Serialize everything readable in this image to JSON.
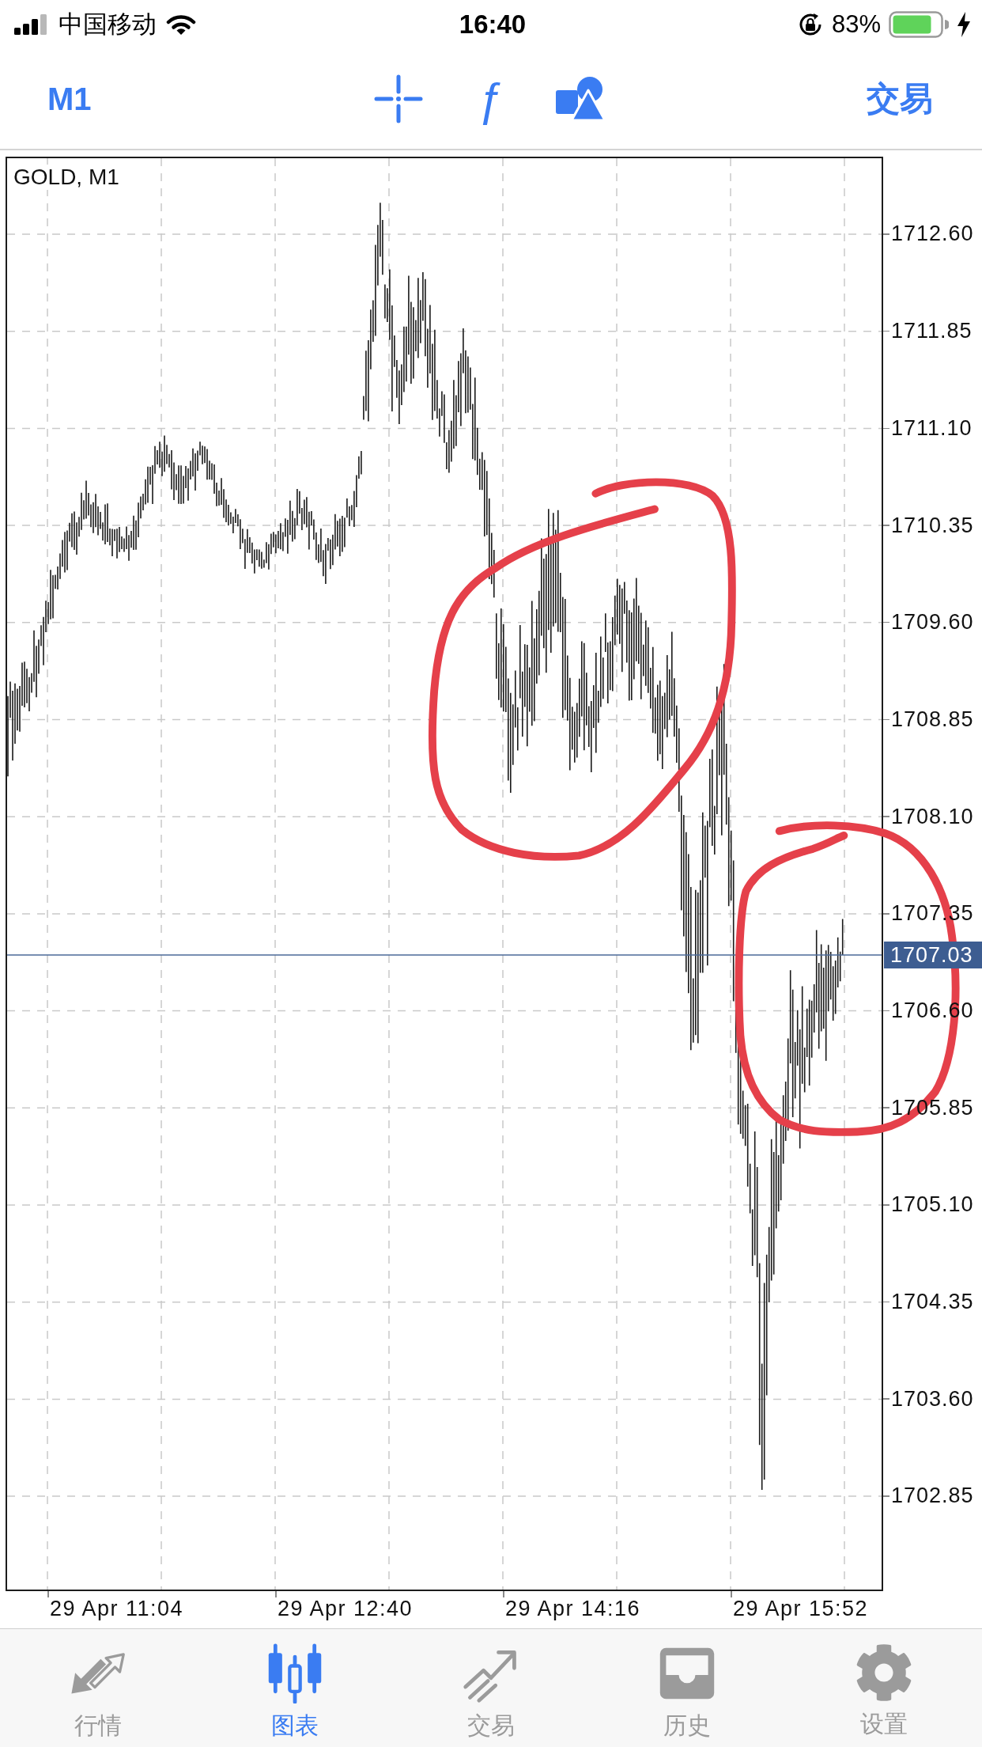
{
  "status_bar": {
    "carrier": "中国移动",
    "time": "16:40",
    "battery": "83%"
  },
  "toolbar": {
    "timeframe": "M1",
    "indicators": "ƒ",
    "trade": "交易"
  },
  "chart": {
    "title": "GOLD, M1",
    "price_labels": [
      "1712.60",
      "1711.85",
      "1711.10",
      "1710.35",
      "1709.60",
      "1708.85",
      "1708.10",
      "1707.35",
      "1706.60",
      "1705.85",
      "1705.10",
      "1704.35",
      "1703.60",
      "1702.85"
    ],
    "current_price": "1707.03",
    "time_labels": [
      "29 Apr 11:04",
      "29 Apr 12:40",
      "29 Apr 14:16",
      "29 Apr 15:52"
    ]
  },
  "tab_bar": [
    {
      "label": "行情",
      "selected": false
    },
    {
      "label": "图表",
      "selected": true
    },
    {
      "label": "交易",
      "selected": false
    },
    {
      "label": "历史",
      "selected": false
    },
    {
      "label": "设置",
      "selected": false
    }
  ]
}
